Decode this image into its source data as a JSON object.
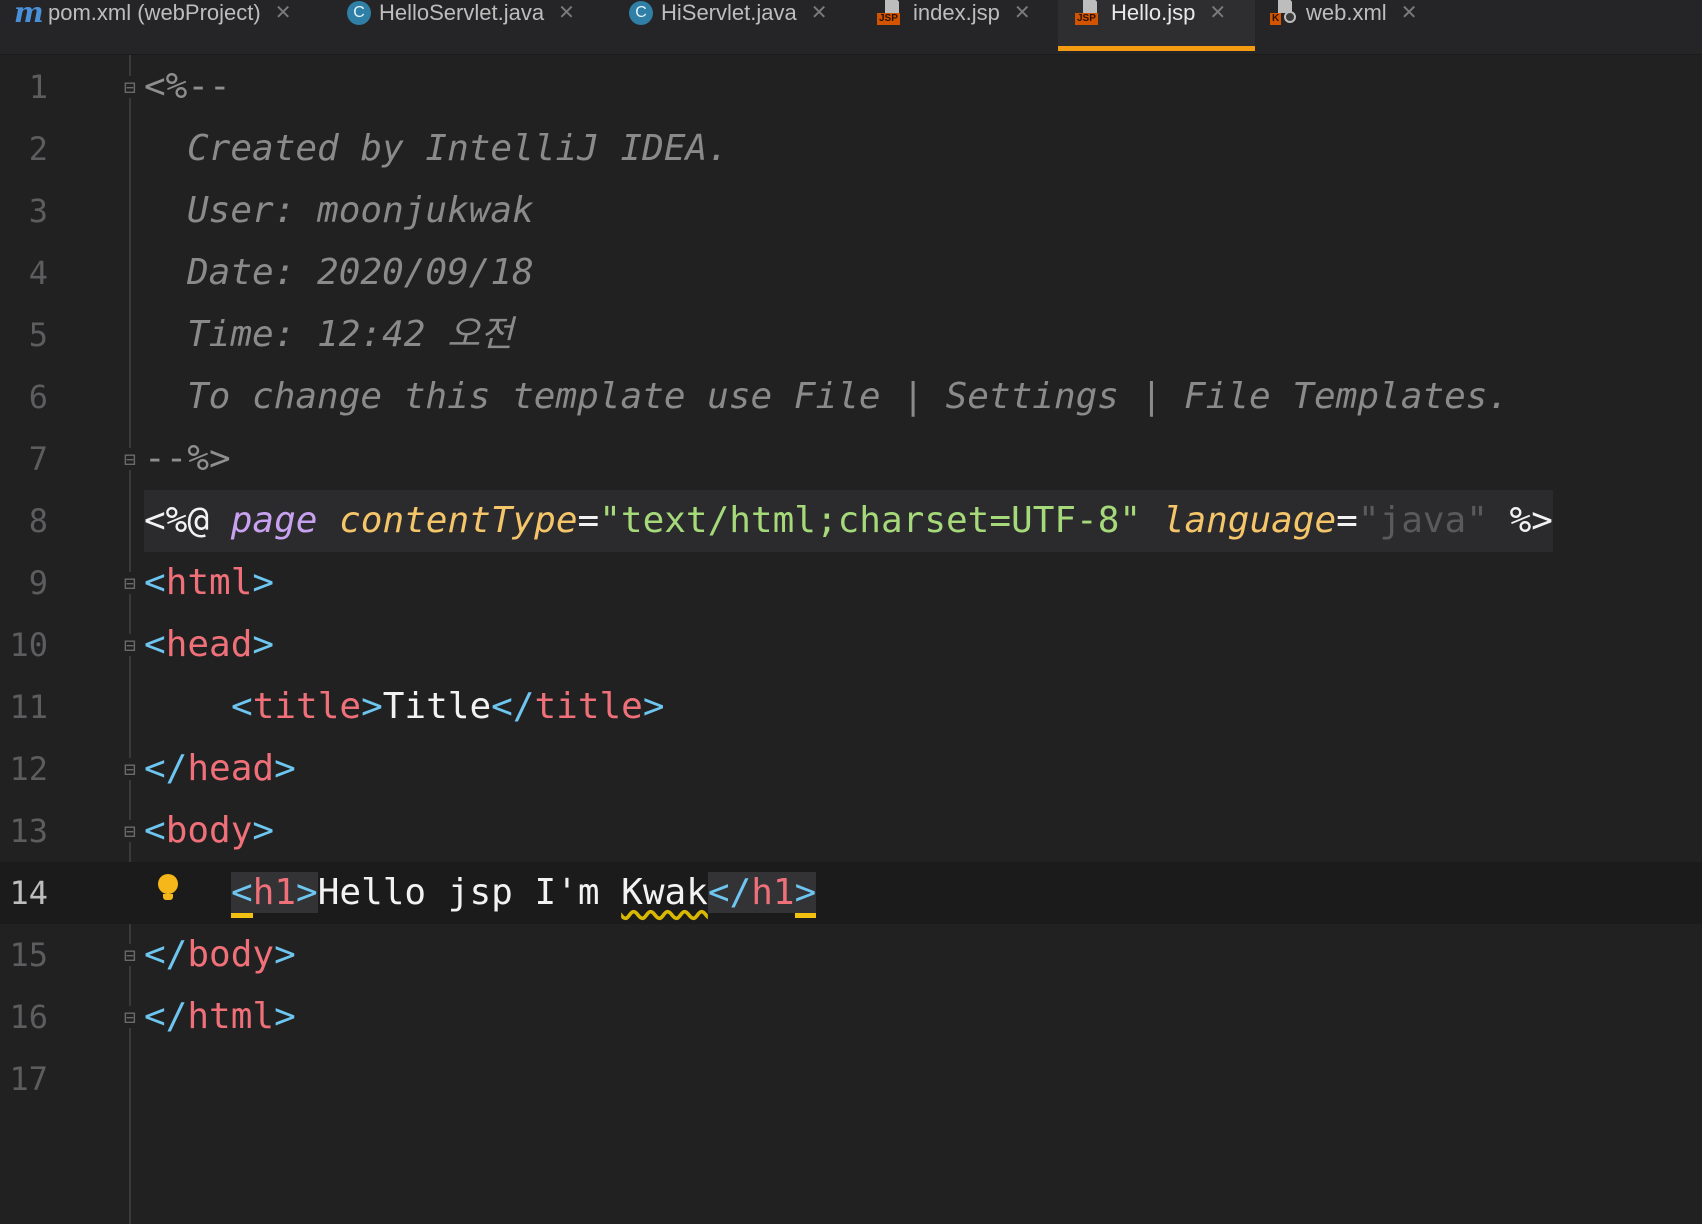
{
  "tabs": [
    {
      "label": "pom.xml (webProject)",
      "icon": "maven-m-icon",
      "active": false
    },
    {
      "label": "HelloServlet.java",
      "icon": "java-class-icon",
      "active": false
    },
    {
      "label": "HiServlet.java",
      "icon": "java-class-icon",
      "active": false
    },
    {
      "label": "index.jsp",
      "icon": "jsp-file-icon",
      "active": false
    },
    {
      "label": "Hello.jsp",
      "icon": "jsp-file-icon",
      "active": true
    },
    {
      "label": "web.xml",
      "icon": "web-xml-file-icon",
      "active": false
    }
  ],
  "icon_glyphs": {
    "maven": "m",
    "java_class": "C",
    "jsp_badge": "JSP",
    "xml_badge": "K",
    "close": "✕"
  },
  "editor": {
    "current_line": 14,
    "line_numbers": [
      "1",
      "2",
      "3",
      "4",
      "5",
      "6",
      "7",
      "8",
      "9",
      "10",
      "11",
      "12",
      "13",
      "14",
      "15",
      "16",
      "17"
    ],
    "lines": {
      "l1": {
        "open": "<%--"
      },
      "l2": {
        "text": "Created by IntelliJ IDEA."
      },
      "l3": {
        "text": "User: moonjukwak"
      },
      "l4": {
        "text": "Date: 2020/09/18"
      },
      "l5": {
        "text": "Time: 12:42 오전"
      },
      "l6": {
        "text": "To change this template use File | Settings | File Templates."
      },
      "l7": {
        "close": "--%>"
      },
      "l8": {
        "open": "<%@",
        "page": "page",
        "attr1": "contentType",
        "eq": "=",
        "val1": "\"text/html;charset=UTF-8\"",
        "attr2": "language",
        "val2": "\"java\"",
        "close": "%>"
      },
      "l9": {
        "lt": "<",
        "tag": "html",
        "gt": ">"
      },
      "l10": {
        "lt": "<",
        "tag": "head",
        "gt": ">"
      },
      "l11": {
        "lt": "<",
        "tag": "title",
        "gt": ">",
        "text": "Title",
        "lt2": "</",
        "gt2": ">"
      },
      "l12": {
        "lt": "</",
        "tag": "head",
        "gt": ">"
      },
      "l13": {
        "lt": "<",
        "tag": "body",
        "gt": ">"
      },
      "l14": {
        "lt": "<",
        "tag": "h1",
        "gt": ">",
        "text": "Hello jsp I'm ",
        "word": "Kwak",
        "lt2": "</",
        "gt2": ">"
      },
      "l15": {
        "lt": "</",
        "tag": "body",
        "gt": ">"
      },
      "l16": {
        "lt": "</",
        "tag": "html",
        "gt": ">"
      }
    }
  },
  "colors": {
    "background": "#212122",
    "active_tab_underline": "#f39c12",
    "tag": "#f0707a",
    "bracket": "#6ec6f0",
    "attribute": "#f5c56a",
    "string": "#a5d97a",
    "keyword": "#c8a2f0",
    "comment": "#8a8a8a",
    "intention_bulb": "#f5b719"
  }
}
